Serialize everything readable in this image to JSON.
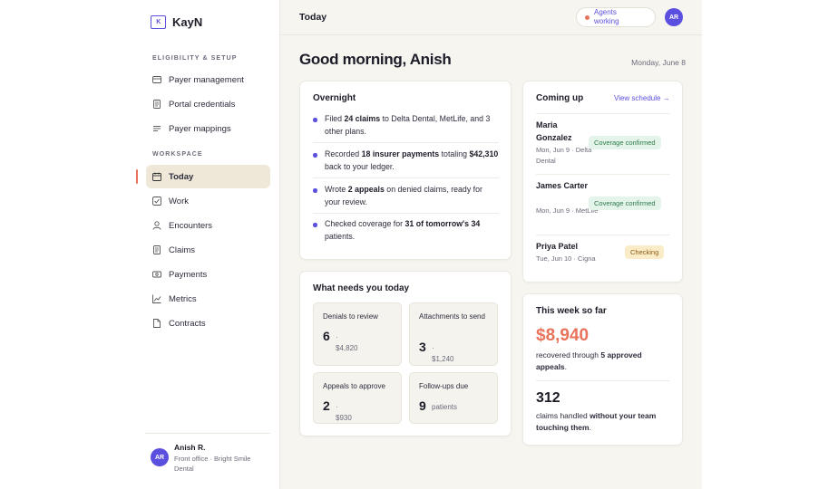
{
  "app": {
    "name": "KayN",
    "logo_text": "K"
  },
  "sidebar": {
    "section_setup": "ELIGIBILITY & SETUP",
    "section_workspace": "WORKSPACE",
    "setup_items": [
      {
        "label": "Payer management",
        "icon": "card-icon"
      },
      {
        "label": "Portal credentials",
        "icon": "document-icon"
      },
      {
        "label": "Payer mappings",
        "icon": "list-icon"
      }
    ],
    "workspace_items": [
      {
        "label": "Today",
        "icon": "calendar-icon",
        "active": true
      },
      {
        "label": "Work",
        "icon": "checkbox-icon"
      },
      {
        "label": "Encounters",
        "icon": "person-icon"
      },
      {
        "label": "Claims",
        "icon": "document-icon"
      },
      {
        "label": "Payments",
        "icon": "money-icon"
      },
      {
        "label": "Metrics",
        "icon": "chart-icon"
      },
      {
        "label": "Contracts",
        "icon": "file-icon"
      }
    ],
    "user": {
      "initials": "AR",
      "name": "Anish R.",
      "role": "Front office · Bright Smile Dental"
    }
  },
  "topbar": {
    "title": "Today",
    "agents_status": "Agents working",
    "avatar": "AR"
  },
  "main": {
    "greeting": "Good morning, Anish",
    "date": "Monday, June 8",
    "overnight": {
      "title": "Overnight",
      "items": [
        {
          "p1": "Filed ",
          "b1": "24 claims",
          "p2": " to Delta Dental, MetLife, and 3 other plans.",
          "b2": "",
          "p3": ""
        },
        {
          "p1": "Recorded ",
          "b1": "18 insurer payments",
          "p2": " totaling ",
          "b2": "$42,310",
          "p3": " back to your ledger."
        },
        {
          "p1": "Wrote ",
          "b1": "2 appeals",
          "p2": " on denied claims, ready for your review.",
          "b2": "",
          "p3": ""
        },
        {
          "p1": "Checked coverage for ",
          "b1": "31 of tomorrow's 34",
          "p2": " patients.",
          "b2": "",
          "p3": ""
        }
      ]
    },
    "needs": {
      "title": "What needs you today",
      "tiles": [
        {
          "label": "Denials to review",
          "num": "6",
          "dot": "·",
          "sub": "$4,820"
        },
        {
          "label": "Attachments to send",
          "num": "3",
          "dot": "·",
          "sub": "$1,240"
        },
        {
          "label": "Appeals to approve",
          "num": "2",
          "dot": "·",
          "sub": "$930"
        },
        {
          "label": "Follow-ups due",
          "num": "9",
          "dot": "",
          "sub": "patients"
        }
      ]
    },
    "coming_up": {
      "title": "Coming up",
      "link": "View schedule →",
      "appointments": [
        {
          "name": "Maria Gonzalez",
          "meta": "Mon, Jun 9 · Delta Dental",
          "status": "Coverage confirmed"
        },
        {
          "name": "James Carter",
          "meta": "Mon, Jun 9 · MetLife",
          "status": "Coverage confirmed"
        },
        {
          "name": "Priya Patel",
          "meta": "Tue, Jun 10 · Cigna",
          "status": "Checking"
        }
      ]
    },
    "week": {
      "title": "This week so far",
      "amount": "$8,940",
      "amount_p1": "recovered through ",
      "amount_b": "5 approved appeals",
      "amount_p2": ".",
      "claims": "312",
      "claims_p1": "claims handled ",
      "claims_b": "without your team touching them",
      "claims_p2": "."
    }
  }
}
